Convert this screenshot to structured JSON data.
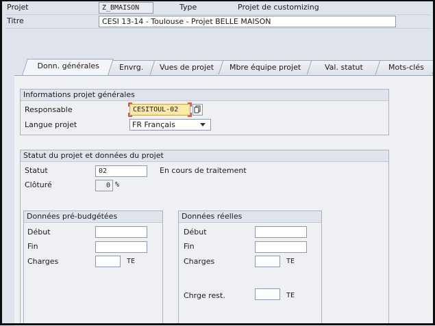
{
  "header": {
    "projet_label": "Projet",
    "projet_value": "Z_BMAISON",
    "type_label": "Type",
    "type_value": "Projet de customizing",
    "titre_label": "Titre",
    "titre_value": "CESI 13-14 - Toulouse - Projet BELLE MAISON"
  },
  "tabs": [
    {
      "label": "Donn. générales",
      "active": true
    },
    {
      "label": "Envrg."
    },
    {
      "label": "Vues de projet"
    },
    {
      "label": "Mbre équipe projet"
    },
    {
      "label": "Val. statut"
    },
    {
      "label": "Mots-clés"
    }
  ],
  "general_info": {
    "title": "Informations projet générales",
    "responsable_label": "Responsable",
    "responsable_value": "CESITOUL-02",
    "langue_label": "Langue projet",
    "langue_value": "FR Français"
  },
  "status_section": {
    "title": "Statut du projet et données du projet",
    "statut_label": "Statut",
    "statut_value": "02",
    "statut_text": "En cours de traitement",
    "cloture_label": "Clôturé",
    "cloture_value": "0",
    "cloture_unit": "%"
  },
  "budget": {
    "title": "Données pré-budgétées",
    "debut_label": "Début",
    "fin_label": "Fin",
    "charges_label": "Charges",
    "charges_unit": "TE"
  },
  "actual": {
    "title": "Données réelles",
    "debut_label": "Début",
    "fin_label": "Fin",
    "charges_label": "Charges",
    "charges_unit": "TE",
    "rest_label": "Chrge rest.",
    "rest_unit": "TE"
  },
  "colors": {
    "accent_focus": "#d9534f",
    "highlight_field": "#ffe9a8"
  }
}
